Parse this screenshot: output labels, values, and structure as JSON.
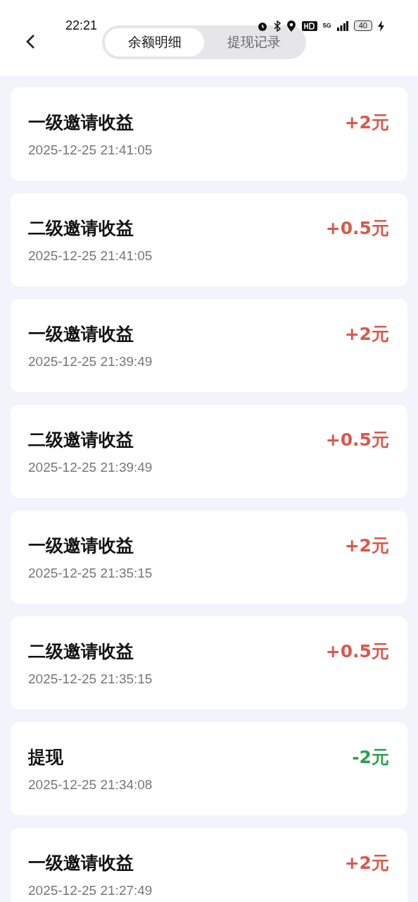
{
  "status_bar": {
    "time": "22:21",
    "network": "5G",
    "battery": "40"
  },
  "tabs": [
    {
      "label": "余额明细",
      "selected": true
    },
    {
      "label": "提现记录",
      "selected": false
    }
  ],
  "records": [
    {
      "title": "一级邀请收益",
      "time": "2025-12-25 21:41:05",
      "amount": "+2元",
      "kind": "income"
    },
    {
      "title": "二级邀请收益",
      "time": "2025-12-25 21:41:05",
      "amount": "+0.5元",
      "kind": "income"
    },
    {
      "title": "一级邀请收益",
      "time": "2025-12-25 21:39:49",
      "amount": "+2元",
      "kind": "income"
    },
    {
      "title": "二级邀请收益",
      "time": "2025-12-25 21:39:49",
      "amount": "+0.5元",
      "kind": "income"
    },
    {
      "title": "一级邀请收益",
      "time": "2025-12-25 21:35:15",
      "amount": "+2元",
      "kind": "income"
    },
    {
      "title": "二级邀请收益",
      "time": "2025-12-25 21:35:15",
      "amount": "+0.5元",
      "kind": "income"
    },
    {
      "title": "提现",
      "time": "2025-12-25 21:34:08",
      "amount": "-2元",
      "kind": "expense"
    },
    {
      "title": "一级邀请收益",
      "time": "2025-12-25 21:27:49",
      "amount": "+2元",
      "kind": "income"
    }
  ]
}
